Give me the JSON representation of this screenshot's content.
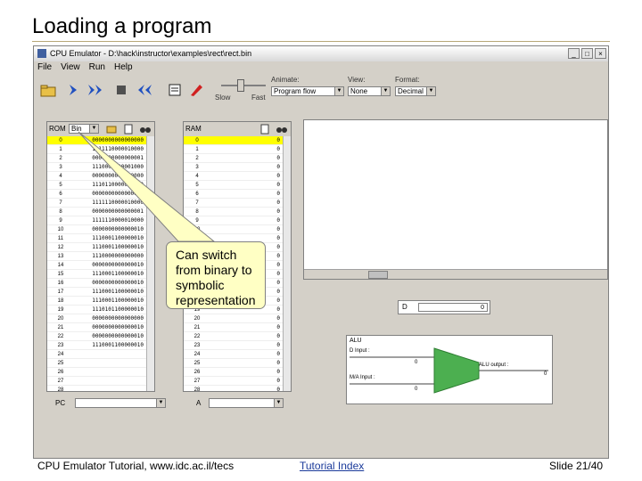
{
  "slide": {
    "title": "Loading a program",
    "footer_left": "CPU Emulator Tutorial, www.idc.ac.il/tecs",
    "footer_link": "Tutorial Index",
    "footer_right": "Slide 21/40"
  },
  "window": {
    "title": "CPU Emulator - D:\\hack\\instructor\\examples\\rect\\rect.bin",
    "menu": [
      "File",
      "View",
      "Run",
      "Help"
    ]
  },
  "toolbar": {
    "slow_label": "Slow",
    "fast_label": "Fast",
    "animate_label": "Animate:",
    "animate_value": "Program flow",
    "view_label": "View:",
    "view_value": "None",
    "format_label": "Format:",
    "format_value": "Decimal"
  },
  "rom": {
    "label": "ROM",
    "format_value": "Bin",
    "rows": [
      {
        "addr": "0",
        "value": "0000000000000000"
      },
      {
        "addr": "1",
        "value": "1111110000010000"
      },
      {
        "addr": "2",
        "value": "0000000000000001"
      },
      {
        "addr": "3",
        "value": "1110001100001000"
      },
      {
        "addr": "4",
        "value": "0000000000000000"
      },
      {
        "addr": "5",
        "value": "1110110000010000"
      },
      {
        "addr": "6",
        "value": "0000000000000000"
      },
      {
        "addr": "7",
        "value": "1111110000010000"
      },
      {
        "addr": "8",
        "value": "0000000000000001"
      },
      {
        "addr": "9",
        "value": "1111110000010000"
      },
      {
        "addr": "10",
        "value": "0000000000000010"
      },
      {
        "addr": "11",
        "value": "1110001100000010"
      },
      {
        "addr": "12",
        "value": "1110001100000010"
      },
      {
        "addr": "13",
        "value": "1110000000000000"
      },
      {
        "addr": "14",
        "value": "0000000000000010"
      },
      {
        "addr": "15",
        "value": "1110001100000010"
      },
      {
        "addr": "16",
        "value": "0000000000000010"
      },
      {
        "addr": "17",
        "value": "1110001100000010"
      },
      {
        "addr": "18",
        "value": "1110001100000010"
      },
      {
        "addr": "19",
        "value": "1110101100000010"
      },
      {
        "addr": "20",
        "value": "0000000000000000"
      },
      {
        "addr": "21",
        "value": "0000000000000010"
      },
      {
        "addr": "22",
        "value": "0000000000000010"
      },
      {
        "addr": "23",
        "value": "1110001100000010"
      },
      {
        "addr": "24",
        "value": ""
      },
      {
        "addr": "25",
        "value": ""
      },
      {
        "addr": "26",
        "value": ""
      },
      {
        "addr": "27",
        "value": ""
      },
      {
        "addr": "28",
        "value": ""
      }
    ],
    "pc_label": "PC"
  },
  "ram": {
    "label": "RAM",
    "rows": [
      {
        "addr": "0",
        "value": "0"
      },
      {
        "addr": "1",
        "value": "0"
      },
      {
        "addr": "2",
        "value": "0"
      },
      {
        "addr": "3",
        "value": "0"
      },
      {
        "addr": "4",
        "value": "0"
      },
      {
        "addr": "5",
        "value": "0"
      },
      {
        "addr": "6",
        "value": "0"
      },
      {
        "addr": "7",
        "value": "0"
      },
      {
        "addr": "8",
        "value": "0"
      },
      {
        "addr": "9",
        "value": "0"
      },
      {
        "addr": "10",
        "value": "0"
      },
      {
        "addr": "11",
        "value": "0"
      },
      {
        "addr": "12",
        "value": "0"
      },
      {
        "addr": "13",
        "value": "0"
      },
      {
        "addr": "14",
        "value": "0"
      },
      {
        "addr": "15",
        "value": "0"
      },
      {
        "addr": "16",
        "value": "0"
      },
      {
        "addr": "17",
        "value": "0"
      },
      {
        "addr": "18",
        "value": "0"
      },
      {
        "addr": "19",
        "value": "0"
      },
      {
        "addr": "20",
        "value": "0"
      },
      {
        "addr": "21",
        "value": "0"
      },
      {
        "addr": "22",
        "value": "0"
      },
      {
        "addr": "23",
        "value": "0"
      },
      {
        "addr": "24",
        "value": "0"
      },
      {
        "addr": "25",
        "value": "0"
      },
      {
        "addr": "26",
        "value": "0"
      },
      {
        "addr": "27",
        "value": "0"
      },
      {
        "addr": "28",
        "value": "0"
      }
    ],
    "a_label": "A"
  },
  "registers": {
    "d_label": "D",
    "d_value": "0"
  },
  "alu": {
    "title": "ALU",
    "d_input_label": "D Input :",
    "m_input_label": "M/A Input :",
    "output_label": "ALU output :",
    "d_input_value": "0",
    "m_input_value": "0",
    "output_value": "0"
  },
  "callout": {
    "text": "Can switch from binary to symbolic representation"
  }
}
